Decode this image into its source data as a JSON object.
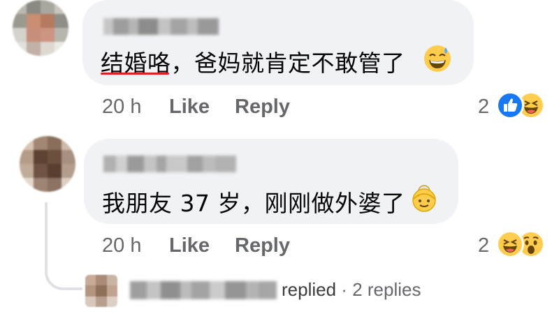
{
  "comments": [
    {
      "text": "结婚咯，爸妈就肯定不敢管了",
      "underlined_text": "结婚咯",
      "emoji": "grinning-face-with-sweat",
      "time": "20 h",
      "like_label": "Like",
      "reply_label": "Reply",
      "reaction_count": "2",
      "reactions": [
        "like",
        "haha"
      ]
    },
    {
      "text": "我朋友 37 岁，刚刚做外婆了",
      "emoji": "older-woman",
      "time": "20 h",
      "like_label": "Like",
      "reply_label": "Reply",
      "reaction_count": "2",
      "reactions": [
        "haha",
        "wow"
      ]
    }
  ],
  "reply_summary": {
    "replied_label": "replied",
    "separator": "·",
    "count_label": "2 replies"
  },
  "colors": {
    "bubble": "#f0f2f5",
    "meta_text": "#65676b",
    "like_blue": "#1877f2",
    "emoji_yellow": "#ffcc4d",
    "underline_red": "#e0201b"
  }
}
